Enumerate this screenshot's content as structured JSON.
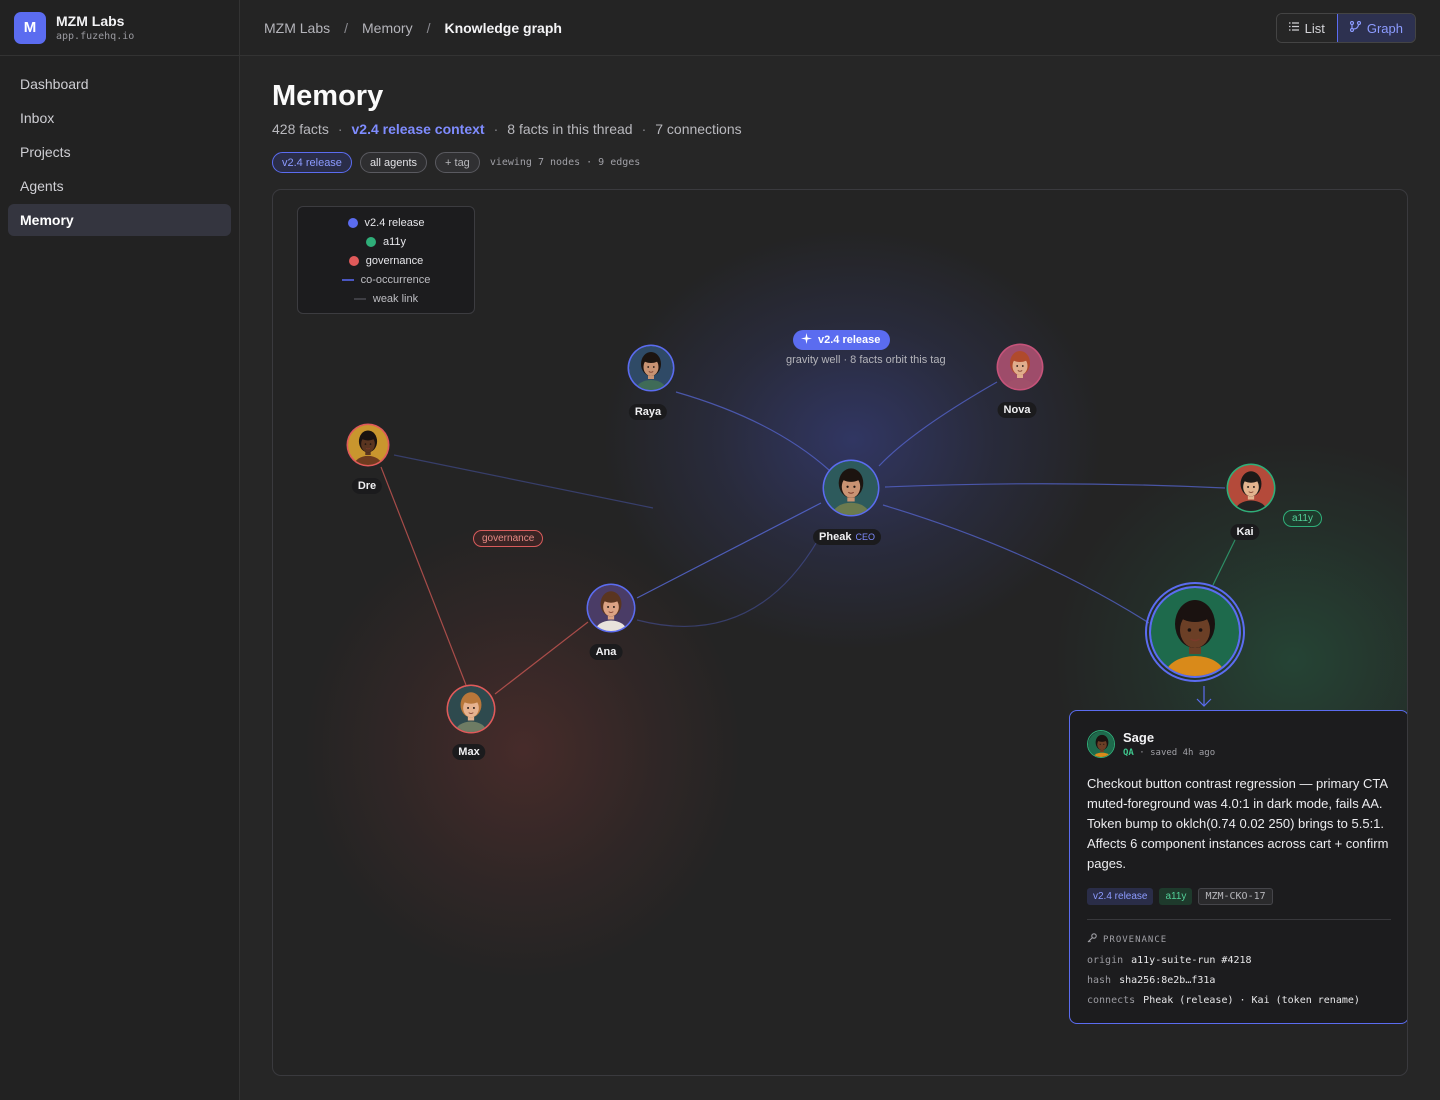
{
  "brand": {
    "logo_letter": "M",
    "name": "MZM Labs",
    "url": "app.fuzehq.io",
    "accent": "#5b6cf0"
  },
  "nav": [
    {
      "label": "Dashboard",
      "active": false
    },
    {
      "label": "Inbox",
      "active": false
    },
    {
      "label": "Projects",
      "active": false
    },
    {
      "label": "Agents",
      "active": false
    },
    {
      "label": "Memory",
      "active": true
    }
  ],
  "breadcrumb": [
    "MZM Labs",
    "Memory",
    "Knowledge graph"
  ],
  "view_toggle": {
    "list_label": "List",
    "graph_label": "Graph",
    "active": "Graph",
    "list_icon": "list-icon",
    "graph_icon": "graph-icon"
  },
  "header": {
    "title": "Memory",
    "facts": "428 facts",
    "context_link": "v2.4 release context",
    "thread_facts": "8 facts in this thread",
    "connections": "7 connections"
  },
  "filters": {
    "tag": "v2.4 release",
    "agents": "all agents",
    "add_tag": "+ tag",
    "viewing": "viewing 7 nodes · 9 edges"
  },
  "legend": [
    {
      "label": "v2.4 release",
      "kind": "dot",
      "color": "#5b6cf0"
    },
    {
      "label": "a11y",
      "kind": "dot",
      "color": "#2fae79"
    },
    {
      "label": "governance",
      "kind": "dot",
      "color": "#e05a5a"
    },
    {
      "label": "co-occurrence",
      "kind": "line",
      "color": "#4a56c0"
    },
    {
      "label": "weak link",
      "kind": "line",
      "color": "#3e3e44"
    }
  ],
  "gravity_well": {
    "label": "v2.4 release",
    "subtitle": "gravity well · 8 facts orbit this tag",
    "icon": "sparkle-icon"
  },
  "graph": {
    "nodes": [
      {
        "id": "raya",
        "label": "Raya",
        "ring": "#5b6cf0",
        "skin": "#c99373",
        "hair": "#1c1410",
        "shirt": "#3f6b57",
        "bg": "#2f4a66"
      },
      {
        "id": "nova",
        "label": "Nova",
        "ring": "#c6537a",
        "skin": "#e0ad8c",
        "hair": "#b04a2c",
        "shirt": "#a0506a",
        "bg": "#9e4c6a"
      },
      {
        "id": "pheak",
        "label": "Pheak",
        "role": "CEO",
        "ring": "#5b6cf0",
        "skin": "#c99373",
        "hair": "#1c1410",
        "shirt": "#6b7a4f",
        "bg": "#2d5a5c"
      },
      {
        "id": "dre",
        "label": "Dre",
        "ring": "#e05a5a",
        "skin": "#5a3520",
        "hair": "#1a1210",
        "shirt": "#6e3b1f",
        "bg": "#c9962e"
      },
      {
        "id": "kai",
        "label": "Kai",
        "ring": "#2fae79",
        "skin": "#e3b48f",
        "hair": "#1d1a18",
        "shirt": "#222",
        "bg": "#b44a3a"
      },
      {
        "id": "ana",
        "label": "Ana",
        "ring": "#5b6cf0",
        "skin": "#dca384",
        "hair": "#5a3520",
        "shirt": "#e8e2dc",
        "bg": "#4a3c66"
      },
      {
        "id": "max",
        "label": "Max",
        "ring": "#e05a5a",
        "skin": "#e6b28f",
        "hair": "#b8773a",
        "shirt": "#6e7c64",
        "bg": "#2e4a4e"
      },
      {
        "id": "sage",
        "label": "Sage",
        "ring": "#5b6cf0",
        "skin": "#6b3f26",
        "hair": "#1a1210",
        "shirt": "#d98a1a",
        "bg": "#1e6a4c"
      }
    ],
    "tags": [
      {
        "id": "governance",
        "label": "governance"
      },
      {
        "id": "a11y",
        "label": "a11y"
      }
    ]
  },
  "detail_card": {
    "name": "Sage",
    "role": "QA",
    "saved": "· saved 4h ago",
    "body": "Checkout button contrast regression — primary CTA muted-foreground was 4.0:1 in dark mode, fails AA. Token bump to oklch(0.74 0.02 250) brings to 5.5:1. Affects 6 component instances across cart + confirm pages.",
    "tags": [
      "v2.4 release",
      "a11y",
      "MZM-CKO-17"
    ],
    "provenance_title": "PROVENANCE",
    "origin_label": "origin",
    "origin": "a11y-suite-run #4218",
    "hash_label": "hash",
    "hash": "sha256:8e2b…f31a",
    "connects_label": "connects",
    "connects": "Pheak (release) · Kai (token rename)"
  }
}
